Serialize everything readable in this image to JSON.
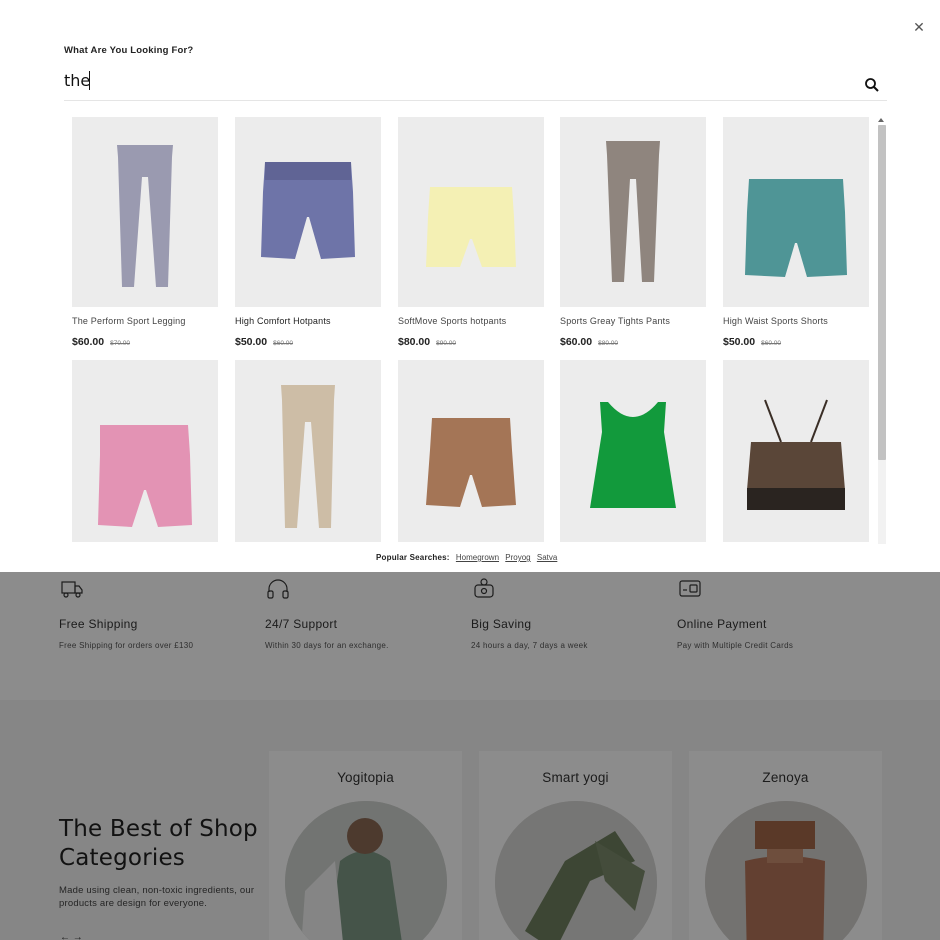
{
  "search": {
    "label": "What Are You Looking For?",
    "value": "the",
    "search_icon": "search-icon",
    "close_icon": "close-icon"
  },
  "products": [
    {
      "name": "The Perform Sport Legging",
      "price": "$60.00",
      "old_price": "$70.00",
      "color": "#9a9ab0"
    },
    {
      "name": "High Comfort Hotpants",
      "price": "$50.00",
      "old_price": "$60.00",
      "color": "#6e74a8"
    },
    {
      "name": "SoftMove Sports hotpants",
      "price": "$80.00",
      "old_price": "$90.00",
      "color": "#f4f0b4"
    },
    {
      "name": "Sports Greay Tights Pants",
      "price": "$60.00",
      "old_price": "$80.00",
      "color": "#8f857e"
    },
    {
      "name": "High Waist Sports Shorts",
      "price": "$50.00",
      "old_price": "$60.00",
      "color": "#4f9596"
    },
    {
      "color": "#e393b4"
    },
    {
      "color": "#cdbda6"
    },
    {
      "color": "#a47556"
    },
    {
      "color": "#129a3c"
    },
    {
      "color": "#5a4638"
    }
  ],
  "popular_searches": {
    "label": "Popular Searches:",
    "links": [
      "Homegrown",
      "Proyog",
      "Satva"
    ]
  },
  "features": [
    {
      "title": "Free Shipping",
      "desc": "Free Shipping for orders over £130",
      "icon": "truck-icon"
    },
    {
      "title": "24/7 Support",
      "desc": "Within 30 days for an exchange.",
      "icon": "headphones-icon"
    },
    {
      "title": "Big Saving",
      "desc": "24 hours a day, 7 days a week",
      "icon": "saving-icon"
    },
    {
      "title": "Online Payment",
      "desc": "Pay with Multiple Credit Cards",
      "icon": "payment-icon"
    }
  ],
  "categories_section": {
    "title": "The Best of Shop Categories",
    "description": "Made using clean, non-toxic ingredients, our products are design for everyone.",
    "categories": [
      "Yogitopia",
      "Smart yogi",
      "Zenoya"
    ]
  },
  "colors": {
    "overlay": "rgba(0,0,0,0.45)",
    "card_bg": "#ececec",
    "panel_bg": "#ffffff"
  }
}
